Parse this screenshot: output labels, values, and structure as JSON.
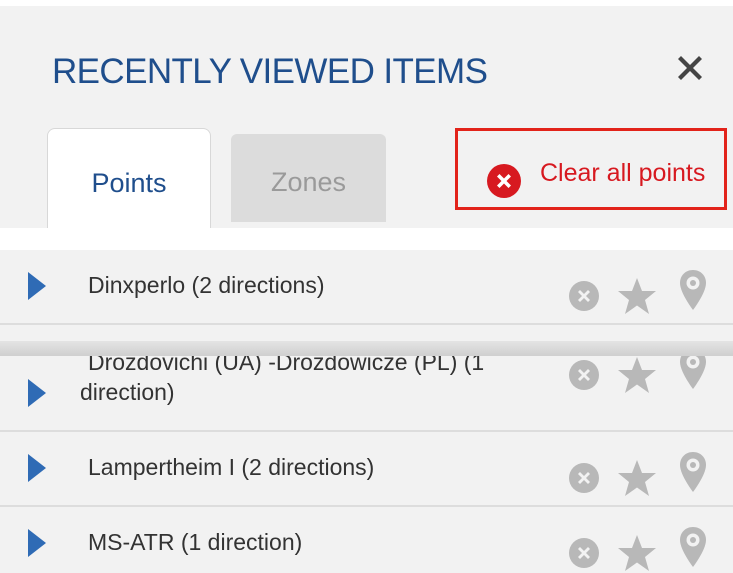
{
  "panel": {
    "title": "RECENTLY VIEWED ITEMS",
    "close_icon": "close-x-icon"
  },
  "tabs": [
    {
      "label": "Points",
      "active": true
    },
    {
      "label": "Zones",
      "active": false
    }
  ],
  "clear_all": {
    "label": "Clear all points",
    "icon": "clear-circle-x-icon",
    "highlight_color": "#e2231a"
  },
  "items": [
    {
      "label": "Dinxperlo (2 directions)"
    },
    {
      "label": "Drozdovichi (UA) -Drozdowicze (PL) (1 direction)"
    },
    {
      "label": "Lampertheim I (2 directions)"
    },
    {
      "label": "MS-ATR (1 direction)"
    }
  ],
  "row_actions": {
    "remove_icon": "remove-circle-icon",
    "favorite_icon": "star-icon",
    "locate_icon": "map-pin-icon"
  },
  "colors": {
    "title": "#1f4e8c",
    "accent_blue": "#2f6bb5",
    "danger": "#d71920",
    "icon_gray": "#b8b8b8"
  }
}
